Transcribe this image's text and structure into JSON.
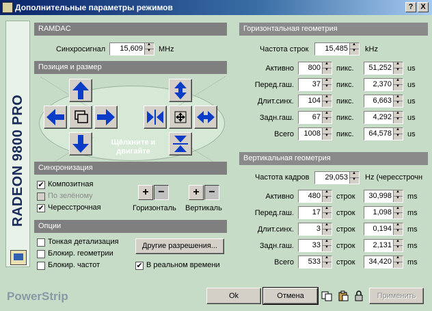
{
  "window": {
    "title": "Дополнительные параметры режимов",
    "help_btn": "?",
    "close_btn": "X"
  },
  "sidebar": {
    "product": "RADEON 9800 PRO"
  },
  "ramdac": {
    "header": "RAMDAC",
    "sync_label": "Синхросигнал",
    "sync_value": "15,609",
    "sync_unit": "MHz"
  },
  "position": {
    "header": "Позиция и размер",
    "click_hint": "Щёлкните и двигайте"
  },
  "sync": {
    "header": "Синхронизация",
    "composite": "Композитная",
    "green": "По зелёному",
    "interlaced": "Чересстрочная",
    "horizontal": "Горизонталь",
    "vertical": "Вертикаль",
    "composite_checked": "✔",
    "interlaced_checked": "✔"
  },
  "options": {
    "header": "Опции",
    "fine": "Тонкая детализация",
    "lock_geom": "Блокир. геометрии",
    "lock_freq": "Блокир. частот",
    "realtime": "В реальном времени",
    "realtime_checked": "✔",
    "other_res": "Другие разрешения..."
  },
  "hgeom": {
    "header": "Горизонтальная геометрия",
    "freq_label": "Частота строк",
    "freq_value": "15,485",
    "freq_unit": "kHz",
    "rows": [
      {
        "label": "Активно",
        "value": "800",
        "unit": "пикс.",
        "time": "51,252",
        "tunit": "us"
      },
      {
        "label": "Перед.гаш.",
        "value": "37",
        "unit": "пикс.",
        "time": "2,370",
        "tunit": "us"
      },
      {
        "label": "Длит.синх.",
        "value": "104",
        "unit": "пикс.",
        "time": "6,663",
        "tunit": "us"
      },
      {
        "label": "Задн.гаш.",
        "value": "67",
        "unit": "пикс.",
        "time": "4,292",
        "tunit": "us"
      },
      {
        "label": "Всего",
        "value": "1008",
        "unit": "пикс.",
        "time": "64,578",
        "tunit": "us"
      }
    ]
  },
  "vgeom": {
    "header": "Вертикальная геометрия",
    "freq_label": "Частота кадров",
    "freq_value": "29,053",
    "freq_unit": "Hz (чересстрочн",
    "rows": [
      {
        "label": "Активно",
        "value": "480",
        "unit": "строк",
        "time": "30,998",
        "tunit": "ms"
      },
      {
        "label": "Перед.гаш.",
        "value": "17",
        "unit": "строк",
        "time": "1,098",
        "tunit": "ms"
      },
      {
        "label": "Длит.синх.",
        "value": "3",
        "unit": "строк",
        "time": "0,194",
        "tunit": "ms"
      },
      {
        "label": "Задн.гаш.",
        "value": "33",
        "unit": "строк",
        "time": "2,131",
        "tunit": "ms"
      },
      {
        "label": "Всего",
        "value": "533",
        "unit": "строк",
        "time": "34,420",
        "tunit": "ms"
      }
    ]
  },
  "footer": {
    "brand": "PowerStrip",
    "ok": "Ok",
    "cancel": "Отмена",
    "apply": "Применить"
  },
  "pm": {
    "plus": "+",
    "minus": "−"
  },
  "colors": {
    "arrow": "#0a3cc8",
    "header_bg": "#7f7f7f",
    "panel_bg": "#c7dcc7"
  }
}
